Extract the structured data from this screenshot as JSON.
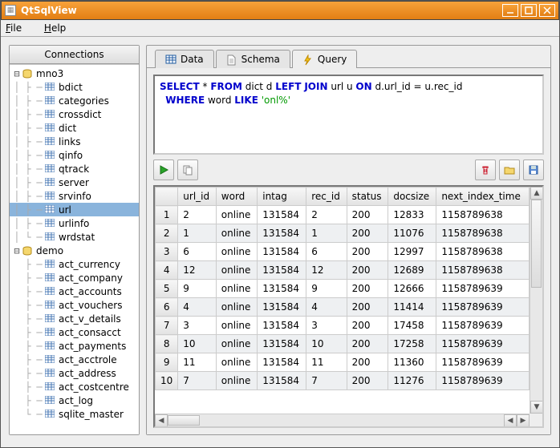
{
  "window": {
    "title": "QtSqlView",
    "menu": {
      "file": "File",
      "help": "Help"
    }
  },
  "sidebar": {
    "header": "Connections",
    "dbs": [
      {
        "name": "mno3",
        "tables": [
          "bdict",
          "categories",
          "crossdict",
          "dict",
          "links",
          "qinfo",
          "qtrack",
          "server",
          "srvinfo",
          "url",
          "urlinfo",
          "wrdstat"
        ],
        "selected": "url"
      },
      {
        "name": "demo",
        "tables": [
          "act_currency",
          "act_company",
          "act_accounts",
          "act_vouchers",
          "act_v_details",
          "act_consacct",
          "act_payments",
          "act_acctrole",
          "act_address",
          "act_costcentre",
          "act_log",
          "sqlite_master"
        ]
      }
    ]
  },
  "tabs": {
    "data": "Data",
    "schema": "Schema",
    "query": "Query",
    "active": "query"
  },
  "query": {
    "sql_parts": [
      {
        "t": "SELECT",
        "c": "kw"
      },
      {
        "t": " * "
      },
      {
        "t": "FROM",
        "c": "kw"
      },
      {
        "t": " dict d "
      },
      {
        "t": "LEFT",
        "c": "kw"
      },
      {
        "t": " "
      },
      {
        "t": "JOIN",
        "c": "kw"
      },
      {
        "t": " url u "
      },
      {
        "t": "ON",
        "c": "kw"
      },
      {
        "t": " d.url_id = u.rec_id"
      },
      {
        "t": "\n "
      },
      {
        "t": "WHERE",
        "c": "kw"
      },
      {
        "t": " word "
      },
      {
        "t": "LIKE",
        "c": "kw"
      },
      {
        "t": " "
      },
      {
        "t": "'onl%'",
        "c": "str"
      }
    ]
  },
  "grid": {
    "columns": [
      "url_id",
      "word",
      "intag",
      "rec_id",
      "status",
      "docsize",
      "next_index_time"
    ],
    "rows": [
      [
        "2",
        "online",
        "131584",
        "2",
        "200",
        "12833",
        "1158789638"
      ],
      [
        "1",
        "online",
        "131584",
        "1",
        "200",
        "11076",
        "1158789638"
      ],
      [
        "6",
        "online",
        "131584",
        "6",
        "200",
        "12997",
        "1158789638"
      ],
      [
        "12",
        "online",
        "131584",
        "12",
        "200",
        "12689",
        "1158789638"
      ],
      [
        "9",
        "online",
        "131584",
        "9",
        "200",
        "12666",
        "1158789639"
      ],
      [
        "4",
        "online",
        "131584",
        "4",
        "200",
        "11414",
        "1158789639"
      ],
      [
        "3",
        "online",
        "131584",
        "3",
        "200",
        "17458",
        "1158789639"
      ],
      [
        "10",
        "online",
        "131584",
        "10",
        "200",
        "17258",
        "1158789639"
      ],
      [
        "11",
        "online",
        "131584",
        "11",
        "200",
        "11360",
        "1158789639"
      ],
      [
        "7",
        "online",
        "131584",
        "7",
        "200",
        "11276",
        "1158789639"
      ]
    ]
  },
  "toolbar_icons": {
    "run": "run",
    "copy": "copy",
    "delete": "delete",
    "open": "open",
    "save": "save"
  }
}
